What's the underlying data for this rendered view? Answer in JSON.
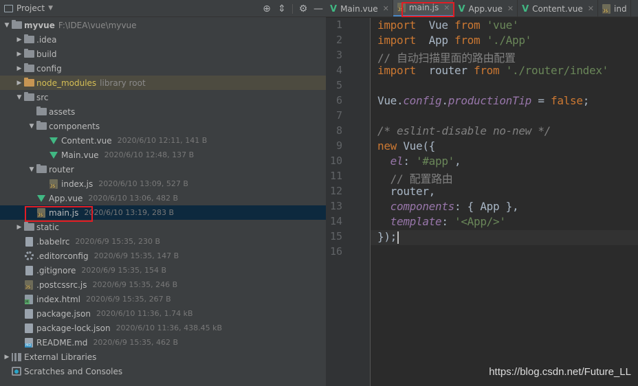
{
  "project_panel": {
    "title": "Project",
    "tools": [
      "target-icon",
      "collapse-icon",
      "gear-icon",
      "minimize-icon"
    ]
  },
  "tree": [
    {
      "depth": 0,
      "expanded": true,
      "icon": "folder-icon",
      "name": "myvue",
      "bold": true,
      "extra": "F:\\IDEA\\vue\\myvue"
    },
    {
      "depth": 1,
      "expanded": false,
      "icon": "folder-icon",
      "name": ".idea"
    },
    {
      "depth": 1,
      "expanded": false,
      "icon": "folder-icon",
      "name": "build"
    },
    {
      "depth": 1,
      "expanded": false,
      "icon": "folder-icon",
      "name": "config"
    },
    {
      "depth": 1,
      "expanded": false,
      "icon": "folder-orange-icon",
      "name": "node_modules",
      "extra": "library root",
      "excluded": true
    },
    {
      "depth": 1,
      "expanded": true,
      "icon": "folder-icon",
      "name": "src"
    },
    {
      "depth": 2,
      "leaf": true,
      "icon": "folder-icon",
      "name": "assets"
    },
    {
      "depth": 2,
      "expanded": true,
      "icon": "folder-icon",
      "name": "components"
    },
    {
      "depth": 3,
      "leaf": true,
      "icon": "vue-icon",
      "name": "Content.vue",
      "meta": "2020/6/10 12:11, 141 B"
    },
    {
      "depth": 3,
      "leaf": true,
      "icon": "vue-icon",
      "name": "Main.vue",
      "meta": "2020/6/10 12:48, 137 B"
    },
    {
      "depth": 2,
      "expanded": true,
      "icon": "folder-icon",
      "name": "router"
    },
    {
      "depth": 3,
      "leaf": true,
      "icon": "js-icon",
      "name": "index.js",
      "meta": "2020/6/10 13:09, 527 B"
    },
    {
      "depth": 2,
      "leaf": true,
      "icon": "vue-icon",
      "name": "App.vue",
      "meta": "2020/6/10 13:06, 482 B"
    },
    {
      "depth": 2,
      "leaf": true,
      "icon": "js-icon",
      "name": "main.js",
      "meta": "2020/6/10 13:19, 283 B",
      "selected": true
    },
    {
      "depth": 1,
      "expanded": false,
      "icon": "folder-icon",
      "name": "static"
    },
    {
      "depth": 1,
      "leaf": true,
      "icon": "file-icon",
      "name": ".babelrc",
      "meta": "2020/6/9 15:35, 230 B"
    },
    {
      "depth": 1,
      "leaf": true,
      "icon": "gear-file-icon",
      "name": ".editorconfig",
      "meta": "2020/6/9 15:35, 147 B"
    },
    {
      "depth": 1,
      "leaf": true,
      "icon": "file-icon",
      "name": ".gitignore",
      "meta": "2020/6/9 15:35, 154 B"
    },
    {
      "depth": 1,
      "leaf": true,
      "icon": "js-icon",
      "name": ".postcssrc.js",
      "meta": "2020/6/9 15:35, 246 B"
    },
    {
      "depth": 1,
      "leaf": true,
      "icon": "html-icon",
      "name": "index.html",
      "meta": "2020/6/9 15:35, 267 B"
    },
    {
      "depth": 1,
      "leaf": true,
      "icon": "json-icon",
      "name": "package.json",
      "meta": "2020/6/10 11:36, 1.74 kB"
    },
    {
      "depth": 1,
      "leaf": true,
      "icon": "json-icon",
      "name": "package-lock.json",
      "meta": "2020/6/10 11:36, 438.45 kB"
    },
    {
      "depth": 1,
      "leaf": true,
      "icon": "md-icon",
      "name": "README.md",
      "meta": "2020/6/9 15:35, 462 B"
    },
    {
      "depth": 0,
      "expanded": false,
      "icon": "library-icon",
      "name": "External Libraries"
    },
    {
      "depth": 0,
      "leaf": true,
      "icon": "scratches-icon",
      "name": "Scratches and Consoles"
    }
  ],
  "tabs": [
    {
      "label": "Main.vue",
      "icon": "vue-icon",
      "active": false
    },
    {
      "label": "main.js",
      "icon": "js-icon",
      "active": true
    },
    {
      "label": "App.vue",
      "icon": "vue-icon",
      "active": false
    },
    {
      "label": "Content.vue",
      "icon": "vue-icon",
      "active": false
    },
    {
      "label": "ind",
      "icon": "js-icon",
      "active": false
    }
  ],
  "code": {
    "line_numbers": [
      "1",
      "2",
      "3",
      "4",
      "5",
      "6",
      "7",
      "8",
      "9",
      "10",
      "11",
      "12",
      "13",
      "14",
      "15",
      "16"
    ],
    "lines": [
      [
        [
          "kw",
          "import"
        ],
        [
          "",
          "  Vue "
        ],
        [
          "kw",
          "from"
        ],
        [
          "",
          " "
        ],
        [
          "str",
          "'vue'"
        ]
      ],
      [
        [
          "kw",
          "import"
        ],
        [
          "",
          "  App "
        ],
        [
          "kw",
          "from"
        ],
        [
          "",
          " "
        ],
        [
          "str",
          "'./App'"
        ]
      ],
      [
        [
          "cm",
          "// 自动扫描里面的路由配置"
        ]
      ],
      [
        [
          "kw",
          "import"
        ],
        [
          "",
          "  router "
        ],
        [
          "kw",
          "from"
        ],
        [
          "",
          " "
        ],
        [
          "str",
          "'./router/index'"
        ]
      ],
      [],
      [
        [
          "",
          "Vue."
        ],
        [
          "prop",
          "config"
        ],
        [
          "",
          "."
        ],
        [
          "prop",
          "productionTip"
        ],
        [
          "",
          " = "
        ],
        [
          "kw",
          "false"
        ],
        [
          "",
          ";"
        ]
      ],
      [],
      [
        [
          "cmi",
          "/* eslint-disable no-new */"
        ]
      ],
      [
        [
          "kw",
          "new"
        ],
        [
          "",
          " Vue({"
        ]
      ],
      [
        [
          "",
          "  "
        ],
        [
          "prop",
          "el"
        ],
        [
          "",
          ": "
        ],
        [
          "str",
          "'#app'"
        ],
        [
          "",
          ","
        ]
      ],
      [
        [
          "",
          "  "
        ],
        [
          "cm",
          "// 配置路由"
        ]
      ],
      [
        [
          "",
          "  router,"
        ]
      ],
      [
        [
          "",
          "  "
        ],
        [
          "prop",
          "components"
        ],
        [
          "",
          ": { App },"
        ]
      ],
      [
        [
          "",
          "  "
        ],
        [
          "prop",
          "template"
        ],
        [
          "",
          ": "
        ],
        [
          "str",
          "'<App/>'"
        ]
      ],
      [
        [
          "",
          "});"
        ]
      ],
      []
    ],
    "current_line": 15
  },
  "watermark": "https://blog.csdn.net/Future_LL"
}
